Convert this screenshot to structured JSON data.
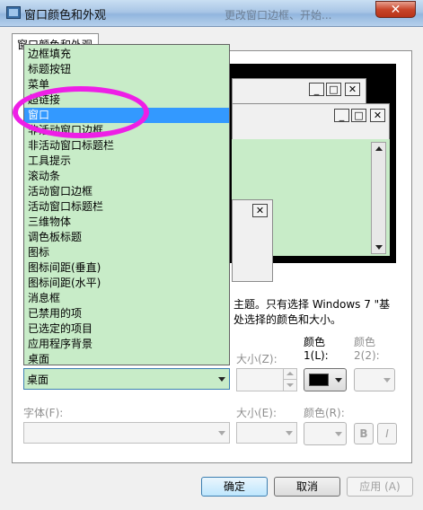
{
  "window": {
    "title": "窗口颜色和外观",
    "background_window_title": "更改窗口边框、开始...",
    "close_symbol": "✕"
  },
  "tab": {
    "label": "窗口颜色和外观"
  },
  "preview": {
    "caption_buttons": [
      "_",
      "□",
      "✕"
    ]
  },
  "description": {
    "line1": "主题。只有选择 Windows 7 \"基",
    "line2": "处选择的颜色和大小。"
  },
  "item_list": {
    "items": [
      "边框填充",
      "标题按钮",
      "菜单",
      "超链接",
      "窗口",
      "非活动窗口边框",
      "非活动窗口标题栏",
      "工具提示",
      "滚动条",
      "活动窗口边框",
      "活动窗口标题栏",
      "三维物体",
      "调色板标题",
      "图标",
      "图标间距(垂直)",
      "图标间距(水平)",
      "消息框",
      "已禁用的项",
      "已选定的项目",
      "应用程序背景",
      "桌面"
    ],
    "selected_index": 4
  },
  "item": {
    "value": "桌面"
  },
  "size1": {
    "label": "大小(Z):",
    "value": ""
  },
  "color1": {
    "label_top": "颜色",
    "label_bottom": "1(L):",
    "swatch": "#000000"
  },
  "color2": {
    "label_top": "颜色",
    "label_bottom": "2(2):"
  },
  "font": {
    "label": "字体(F):",
    "value": ""
  },
  "size2": {
    "label": "大小(E):"
  },
  "color3": {
    "label": "颜色(R):"
  },
  "style_buttons": {
    "bold": "B",
    "italic": "I"
  },
  "buttons": {
    "ok": "确定",
    "cancel": "取消",
    "apply": "应用 (A)"
  },
  "colors": {
    "accent": "#3399ff",
    "list_bg": "#c8ecc8",
    "annotation": "#ee1fe6"
  }
}
